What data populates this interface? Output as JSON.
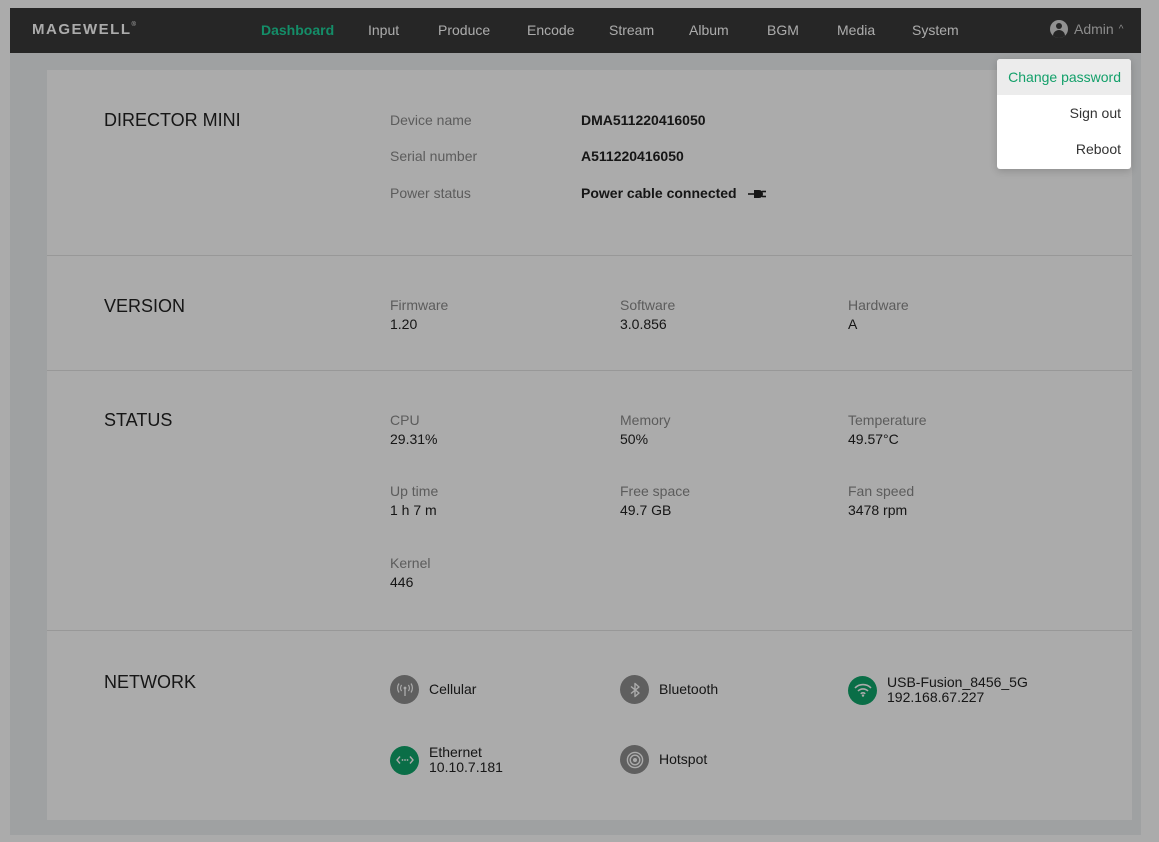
{
  "brand": {
    "logo_text": "MAGEWELL",
    "registered": "®"
  },
  "nav": {
    "items": [
      {
        "label": "Dashboard",
        "active": true
      },
      {
        "label": "Input"
      },
      {
        "label": "Produce"
      },
      {
        "label": "Encode"
      },
      {
        "label": "Stream"
      },
      {
        "label": "Album"
      },
      {
        "label": "BGM"
      },
      {
        "label": "Media"
      },
      {
        "label": "System"
      }
    ]
  },
  "user": {
    "name": "Admin",
    "chevron": "^"
  },
  "user_menu": {
    "items": [
      {
        "label": "Change password",
        "highlighted": true
      },
      {
        "label": "Sign out"
      },
      {
        "label": "Reboot"
      }
    ]
  },
  "device": {
    "title": "DIRECTOR MINI",
    "device_name_label": "Device name",
    "device_name": "DMA511220416050",
    "serial_label": "Serial number",
    "serial": "A511220416050",
    "power_label": "Power status",
    "power": "Power cable connected",
    "power_icon": "plug-icon"
  },
  "version": {
    "title": "VERSION",
    "firmware_label": "Firmware",
    "firmware": "1.20",
    "software_label": "Software",
    "software": "3.0.856",
    "hardware_label": "Hardware",
    "hardware": "A"
  },
  "status": {
    "title": "STATUS",
    "cpu_label": "CPU",
    "cpu": "29.31%",
    "memory_label": "Memory",
    "memory": "50%",
    "temperature_label": "Temperature",
    "temperature": "49.57°C",
    "uptime_label": "Up time",
    "uptime": "1 h 7 m",
    "free_space_label": "Free space",
    "free_space": "49.7 GB",
    "fan_label": "Fan speed",
    "fan": "3478 rpm",
    "kernel_label": "Kernel",
    "kernel": "446"
  },
  "network": {
    "title": "NETWORK",
    "cellular": {
      "label": "Cellular",
      "state": "inactive",
      "icon": "cellular-icon"
    },
    "bluetooth": {
      "label": "Bluetooth",
      "state": "inactive",
      "icon": "bluetooth-icon"
    },
    "wifi": {
      "ssid": "USB-Fusion_8456_5G",
      "ip": "192.168.67.227",
      "state": "connected",
      "icon": "wifi-icon"
    },
    "ethernet": {
      "label": "Ethernet",
      "ip": "10.10.7.181",
      "state": "connected",
      "icon": "ethernet-icon"
    },
    "hotspot": {
      "label": "Hotspot",
      "state": "inactive",
      "icon": "hotspot-icon"
    }
  },
  "colors": {
    "accent": "#1ed39b",
    "connected": "#10a56b",
    "inactive": "#8e8e8e",
    "topbar": "#3a3a3a"
  }
}
